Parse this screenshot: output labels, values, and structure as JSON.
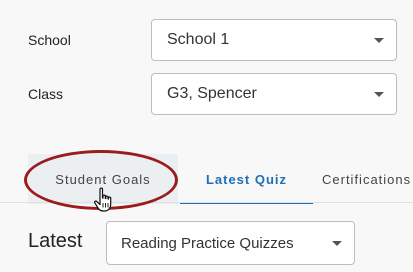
{
  "filters": {
    "school": {
      "label": "School",
      "value": "School 1"
    },
    "class": {
      "label": "Class",
      "value": "G3, Spencer"
    }
  },
  "tabs": [
    {
      "label": "Student Goals",
      "state": "hovered"
    },
    {
      "label": "Latest Quiz",
      "state": "active"
    },
    {
      "label": "Certifications",
      "state": "default"
    }
  ],
  "section": {
    "title": "Latest",
    "quiz_type": "Reading Practice Quizzes"
  },
  "colors": {
    "accent": "#1f6fb8",
    "highlight": "#9b1c1c"
  },
  "icons": {
    "caret": "caret-down-icon",
    "cursor": "hand-pointer-icon"
  }
}
